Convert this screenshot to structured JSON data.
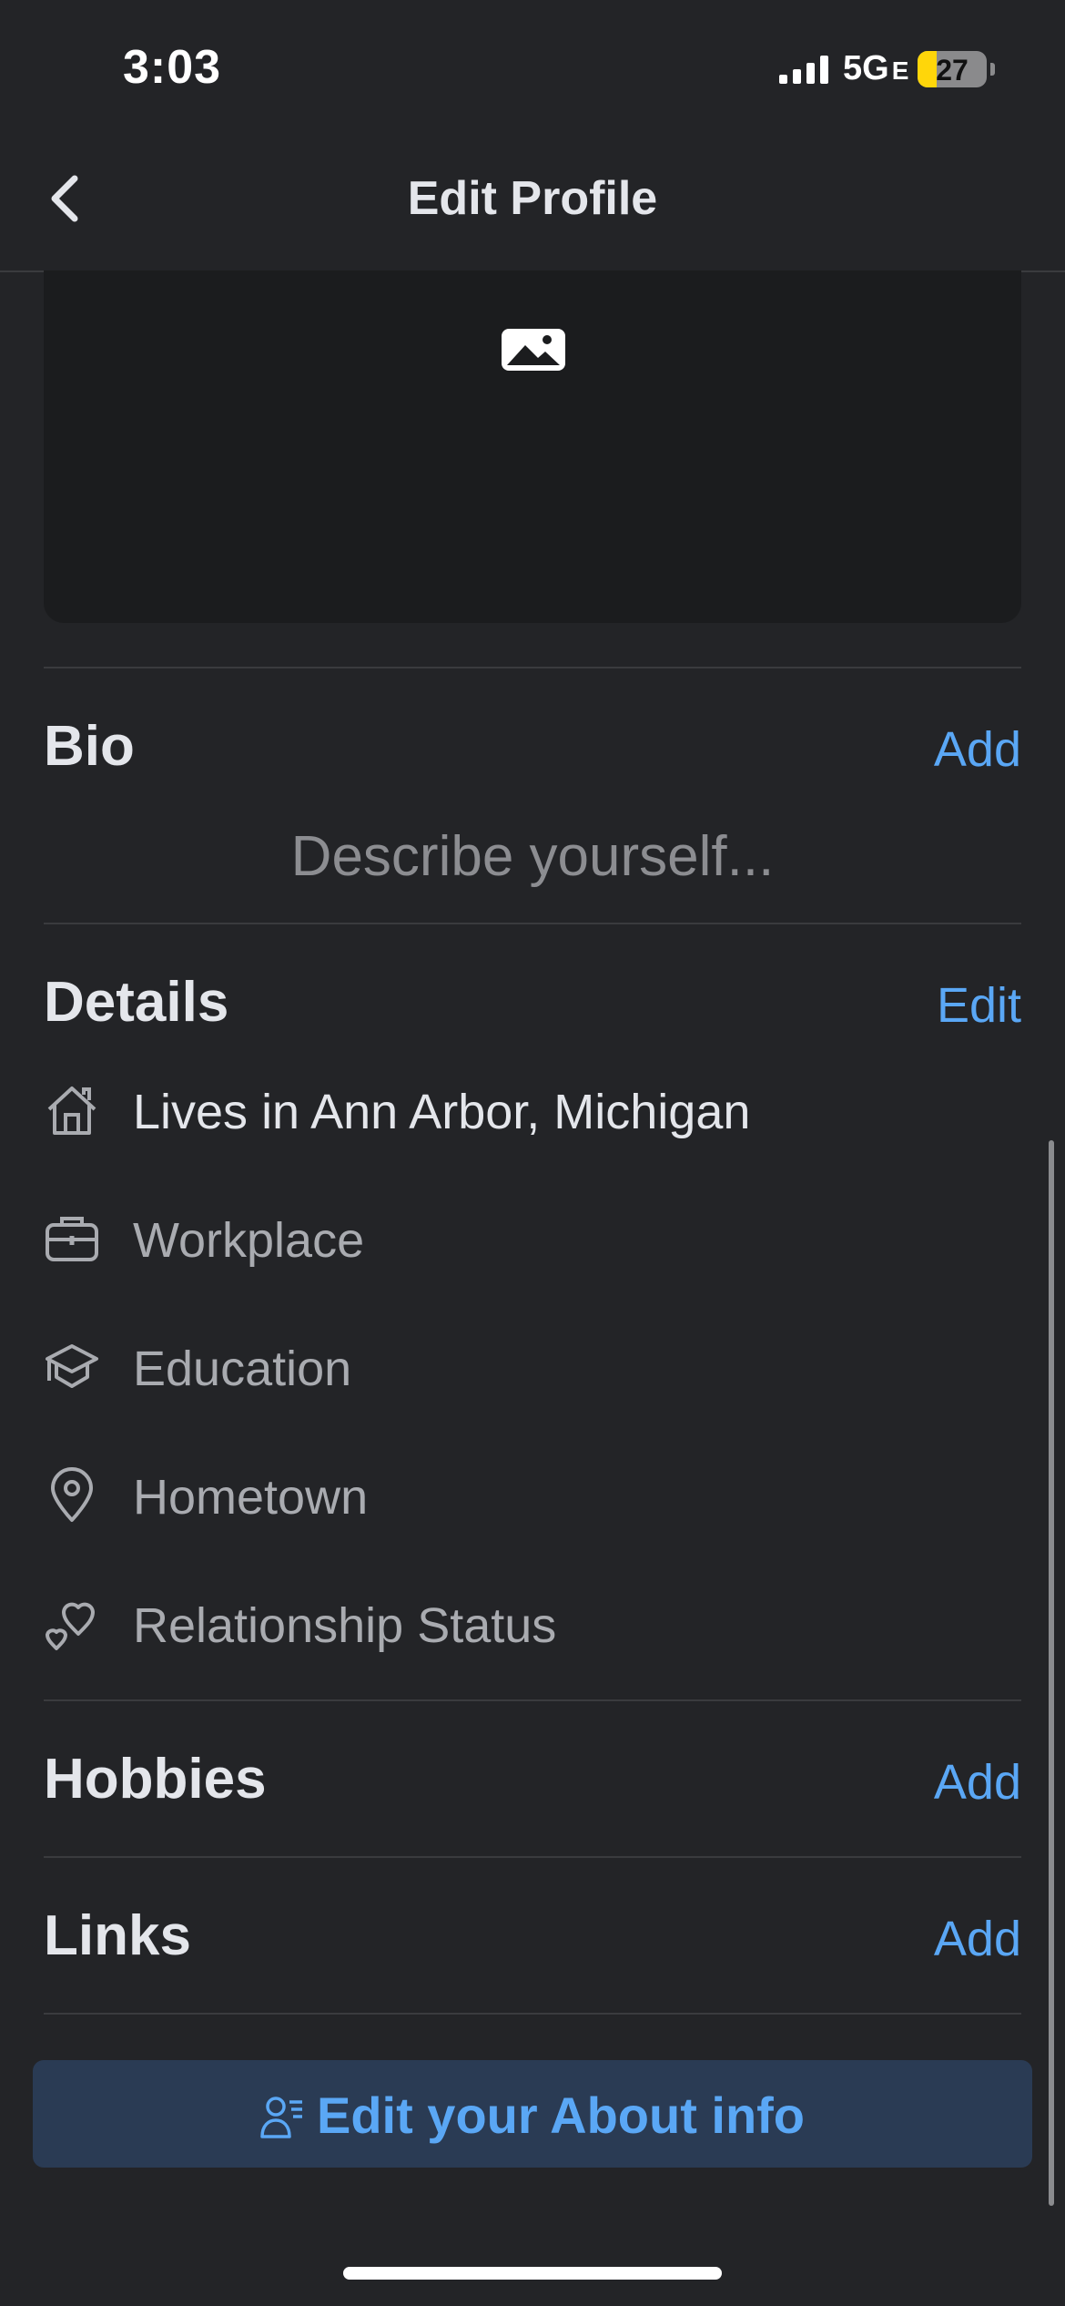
{
  "status_bar": {
    "time": "3:03",
    "network": "5G",
    "network_suffix": "E",
    "battery": "27",
    "battery_level": 0.27,
    "icons": [
      "signal-icon",
      "battery-icon"
    ]
  },
  "header": {
    "title": "Edit Profile",
    "back_icon": "chevron-left-icon"
  },
  "cover": {
    "icon": "image-icon"
  },
  "bio": {
    "title": "Bio",
    "action": "Add",
    "placeholder": "Describe yourself..."
  },
  "details": {
    "title": "Details",
    "action": "Edit",
    "items": [
      {
        "icon": "home-icon",
        "label": "Lives in Ann Arbor, Michigan",
        "filled": true
      },
      {
        "icon": "briefcase-icon",
        "label": "Workplace",
        "filled": false
      },
      {
        "icon": "graduation-cap-icon",
        "label": "Education",
        "filled": false
      },
      {
        "icon": "location-pin-icon",
        "label": "Hometown",
        "filled": false
      },
      {
        "icon": "hearts-icon",
        "label": "Relationship Status",
        "filled": false
      }
    ]
  },
  "hobbies": {
    "title": "Hobbies",
    "action": "Add"
  },
  "links": {
    "title": "Links",
    "action": "Add"
  },
  "about_button": {
    "label": "Edit your About info",
    "icon": "person-info-icon"
  },
  "colors": {
    "background": "#232427",
    "accent": "#5aa7f5",
    "button_bg": "#2a3b54",
    "text_primary": "#e4e6eb",
    "text_secondary": "#a9abb0"
  }
}
